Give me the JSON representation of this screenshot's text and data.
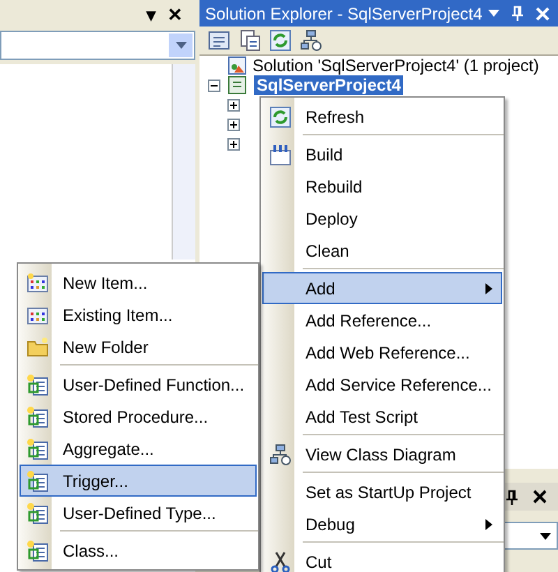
{
  "left_panel": {
    "title_buttons": [
      "▾",
      "✕"
    ]
  },
  "solution_explorer": {
    "title": "Solution Explorer - SqlServerProject4",
    "tree": [
      {
        "label": "Solution 'SqlServerProject4' (1 project)",
        "children": [
          {
            "label": "SqlServerProject4",
            "selected": true,
            "expanded": true,
            "children": [
              {
                "expanded": false
              },
              {
                "expanded": false
              },
              {
                "expanded": false
              }
            ]
          }
        ]
      }
    ]
  },
  "context_menu": [
    {
      "kind": "item",
      "label": "Refresh",
      "selected": false,
      "submenu": false
    },
    {
      "kind": "separator"
    },
    {
      "kind": "item",
      "label": "Build",
      "selected": false,
      "submenu": false
    },
    {
      "kind": "item",
      "label": "Rebuild",
      "selected": false,
      "submenu": false
    },
    {
      "kind": "item",
      "label": "Deploy",
      "selected": false,
      "submenu": false
    },
    {
      "kind": "item",
      "label": "Clean",
      "selected": false,
      "submenu": false
    },
    {
      "kind": "separator"
    },
    {
      "kind": "item",
      "label": "Add",
      "selected": true,
      "submenu": true
    },
    {
      "kind": "item",
      "label": "Add Reference...",
      "selected": false,
      "submenu": false
    },
    {
      "kind": "item",
      "label": "Add Web Reference...",
      "selected": false,
      "submenu": false
    },
    {
      "kind": "item",
      "label": "Add Service Reference...",
      "selected": false,
      "submenu": false
    },
    {
      "kind": "item",
      "label": "Add Test Script",
      "selected": false,
      "submenu": false
    },
    {
      "kind": "separator"
    },
    {
      "kind": "item",
      "label": "View Class Diagram",
      "selected": false,
      "submenu": false
    },
    {
      "kind": "separator"
    },
    {
      "kind": "item",
      "label": "Set as StartUp Project",
      "selected": false,
      "submenu": false
    },
    {
      "kind": "item",
      "label": "Debug",
      "selected": false,
      "submenu": true
    },
    {
      "kind": "separator"
    },
    {
      "kind": "item",
      "label": "Cut",
      "selected": false,
      "submenu": false
    }
  ],
  "add_submenu": [
    {
      "kind": "item",
      "label": "New Item...",
      "selected": false
    },
    {
      "kind": "item",
      "label": "Existing Item...",
      "selected": false
    },
    {
      "kind": "item",
      "label": "New Folder",
      "selected": false
    },
    {
      "kind": "separator"
    },
    {
      "kind": "item",
      "label": "User-Defined Function...",
      "selected": false
    },
    {
      "kind": "item",
      "label": "Stored Procedure...",
      "selected": false
    },
    {
      "kind": "item",
      "label": "Aggregate...",
      "selected": false
    },
    {
      "kind": "item",
      "label": "Trigger...",
      "selected": true
    },
    {
      "kind": "item",
      "label": "User-Defined Type...",
      "selected": false
    },
    {
      "kind": "separator"
    },
    {
      "kind": "item",
      "label": "Class...",
      "selected": false
    }
  ]
}
